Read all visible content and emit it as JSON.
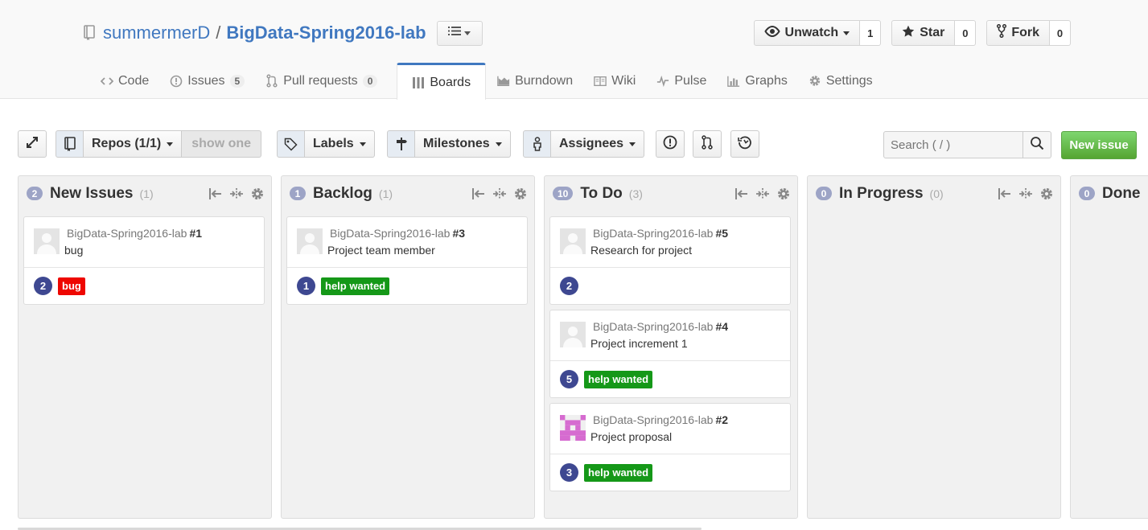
{
  "repo": {
    "owner": "summermerD",
    "separator": "/",
    "name": "BigData-Spring2016-lab"
  },
  "actions": {
    "watch": {
      "label": "Unwatch",
      "count": "1"
    },
    "star": {
      "label": "Star",
      "count": "0"
    },
    "fork": {
      "label": "Fork",
      "count": "0"
    }
  },
  "nav": {
    "code": {
      "label": "Code"
    },
    "issues": {
      "label": "Issues",
      "count": "5"
    },
    "pulls": {
      "label": "Pull requests",
      "count": "0"
    },
    "boards": {
      "label": "Boards"
    },
    "burndown": {
      "label": "Burndown"
    },
    "wiki": {
      "label": "Wiki"
    },
    "pulse": {
      "label": "Pulse"
    },
    "graphs": {
      "label": "Graphs"
    },
    "settings": {
      "label": "Settings"
    }
  },
  "toolbar": {
    "repos_label": "Repos (1/1)",
    "show_one_label": "show one",
    "labels_label": "Labels",
    "milestones_label": "Milestones",
    "assignees_label": "Assignees",
    "search_placeholder": "Search ( / )",
    "new_issue_label": "New issue"
  },
  "colors": {
    "accent": "#4078c0",
    "points_badge": "#3e4891",
    "column_count": "#9da4c6",
    "label_bug": "#ee0701",
    "label_help_wanted": "#159818",
    "new_issue": "#55a532"
  },
  "columns": [
    {
      "name": "New Issues",
      "count": "2",
      "total": "(1)",
      "cards": [
        {
          "repo": "BigData-Spring2016-lab",
          "number": "#1",
          "title": "bug",
          "points": "2",
          "label": "bug"
        }
      ]
    },
    {
      "name": "Backlog",
      "count": "1",
      "total": "(1)",
      "cards": [
        {
          "repo": "BigData-Spring2016-lab",
          "number": "#3",
          "title": "Project team member",
          "points": "1",
          "label": "help wanted"
        }
      ]
    },
    {
      "name": "To Do",
      "count": "10",
      "total": "(3)",
      "cards": [
        {
          "repo": "BigData-Spring2016-lab",
          "number": "#5",
          "title": "Research for project",
          "points": "2",
          "label": ""
        },
        {
          "repo": "BigData-Spring2016-lab",
          "number": "#4",
          "title": "Project increment 1",
          "points": "5",
          "label": "help wanted"
        },
        {
          "repo": "BigData-Spring2016-lab",
          "number": "#2",
          "title": "Project proposal",
          "points": "3",
          "label": "help wanted"
        }
      ]
    },
    {
      "name": "In Progress",
      "count": "0",
      "total": "(0)",
      "cards": []
    },
    {
      "name": "Done",
      "count": "0",
      "total": "",
      "cards": []
    }
  ]
}
